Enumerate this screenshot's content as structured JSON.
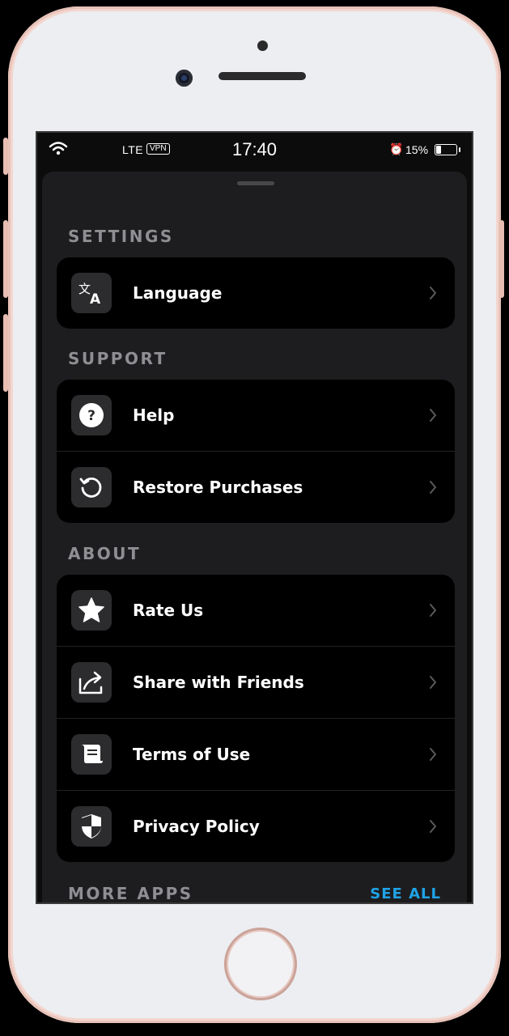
{
  "status_bar": {
    "carrier": "LTE",
    "vpn": "VPN",
    "time": "17:40",
    "battery_percent": "15%"
  },
  "settings": {
    "title": "SETTINGS",
    "items": [
      {
        "label": "Language",
        "icon": "translate-icon"
      }
    ]
  },
  "support": {
    "title": "SUPPORT",
    "items": [
      {
        "label": "Help",
        "icon": "question-icon"
      },
      {
        "label": "Restore Purchases",
        "icon": "restore-icon"
      }
    ]
  },
  "about": {
    "title": "ABOUT",
    "items": [
      {
        "label": "Rate Us",
        "icon": "star-icon"
      },
      {
        "label": "Share with Friends",
        "icon": "share-icon"
      },
      {
        "label": "Terms of Use",
        "icon": "scroll-icon"
      },
      {
        "label": "Privacy Policy",
        "icon": "shield-icon"
      }
    ]
  },
  "more_apps": {
    "title": "MORE APPS",
    "see_all": "SEE ALL"
  },
  "colors": {
    "background": "#1d1d1f",
    "group": "#000000",
    "section_title": "#8e8e93",
    "accent": "#1fa3e6"
  }
}
